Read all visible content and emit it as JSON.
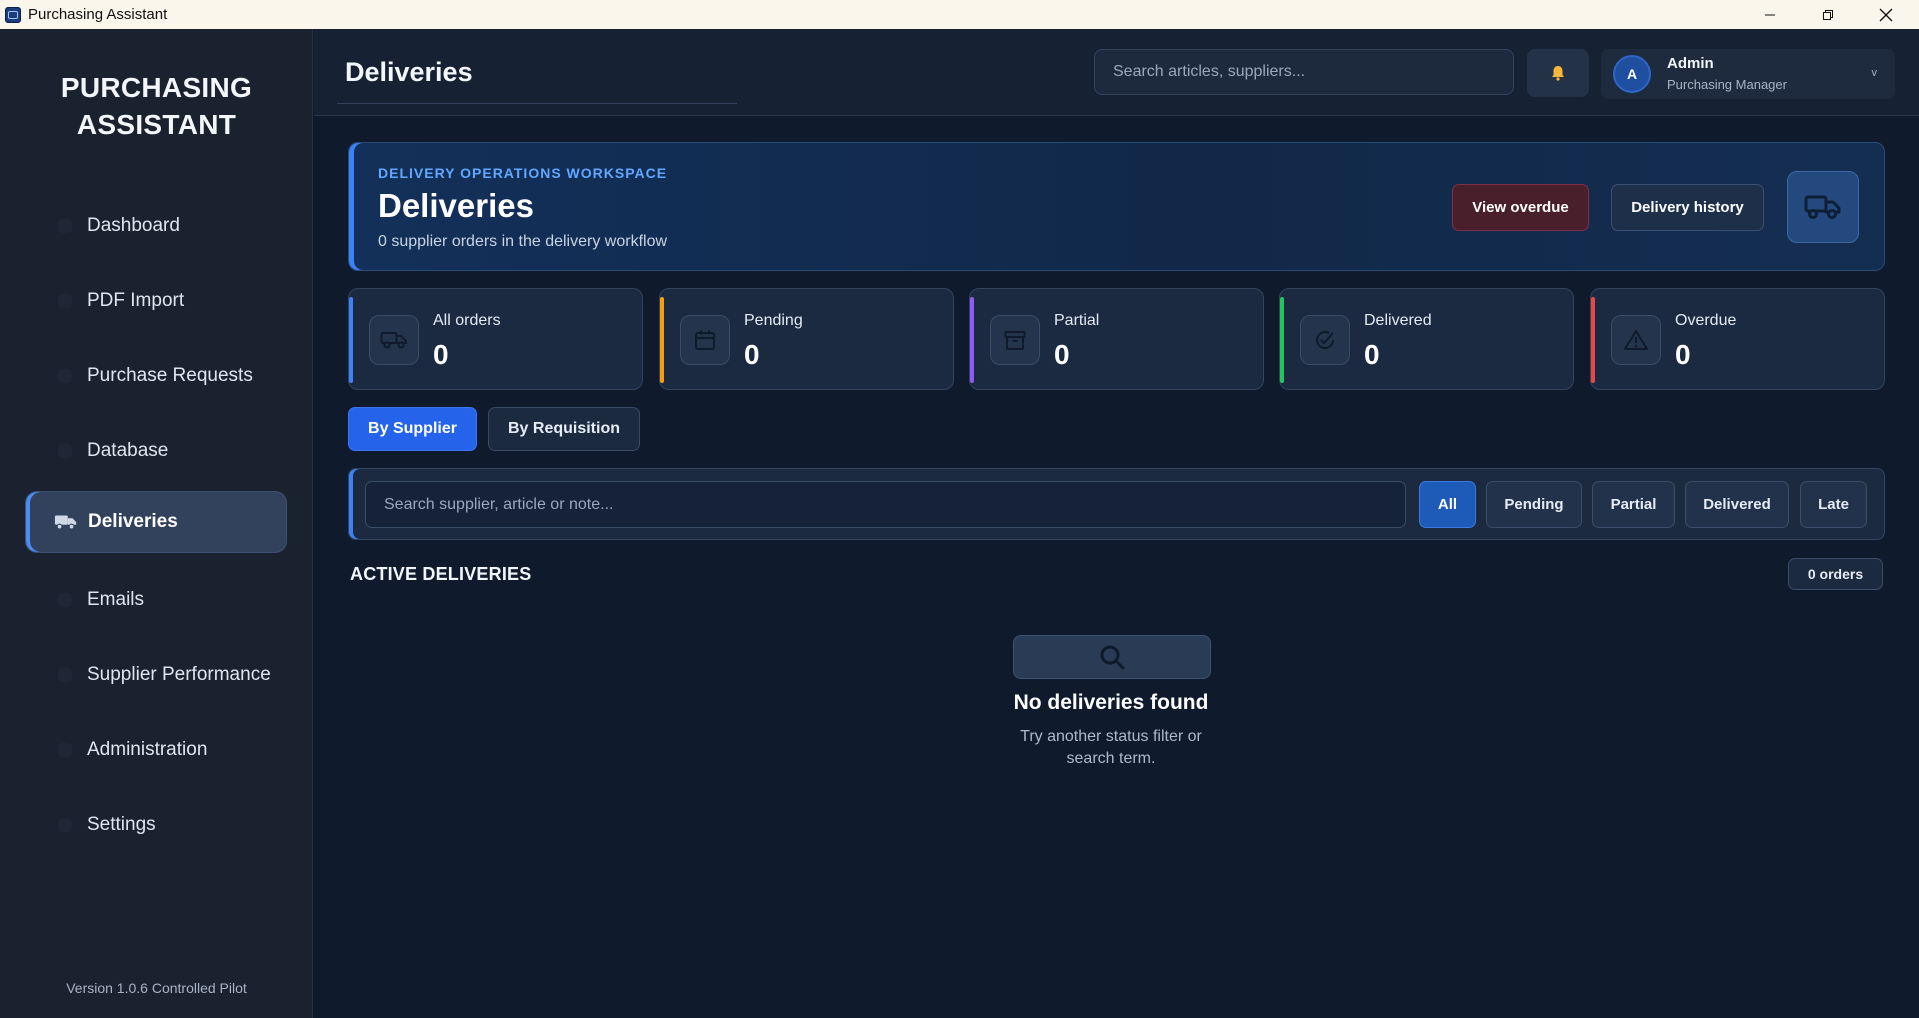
{
  "window": {
    "title": "Purchasing Assistant"
  },
  "sidebar": {
    "brand_line1": "PURCHASING",
    "brand_line2": "ASSISTANT",
    "items": [
      {
        "label": "Dashboard"
      },
      {
        "label": "PDF Import"
      },
      {
        "label": "Purchase Requests"
      },
      {
        "label": "Database"
      },
      {
        "label": "Deliveries",
        "active": true,
        "icon": "truck-icon"
      },
      {
        "label": "Emails"
      },
      {
        "label": "Supplier Performance"
      },
      {
        "label": "Administration"
      },
      {
        "label": "Settings"
      }
    ],
    "version": "Version 1.0.6 Controlled Pilot"
  },
  "header": {
    "page_title": "Deliveries",
    "search_placeholder": "Search articles, suppliers...",
    "notification_icon": "bell-icon",
    "user": {
      "initial": "A",
      "name": "Admin",
      "role": "Purchasing Manager",
      "menu_chevron": "v"
    }
  },
  "hero": {
    "eyebrow": "DELIVERY OPERATIONS WORKSPACE",
    "title": "Deliveries",
    "subtitle": "0 supplier orders in the delivery workflow",
    "view_overdue": "View overdue",
    "delivery_history": "Delivery history"
  },
  "stats": [
    {
      "label": "All orders",
      "value": "0",
      "icon": "truck-icon",
      "accent": "#3b82f6"
    },
    {
      "label": "Pending",
      "value": "0",
      "icon": "calendar-icon",
      "accent": "#f59e0b"
    },
    {
      "label": "Partial",
      "value": "0",
      "icon": "archive-icon",
      "accent": "#8b5cf6"
    },
    {
      "label": "Delivered",
      "value": "0",
      "icon": "check-circle-icon",
      "accent": "#22c55e"
    },
    {
      "label": "Overdue",
      "value": "0",
      "icon": "warning-icon",
      "accent": "#ef4444"
    }
  ],
  "view_toggle": {
    "by_supplier": "By Supplier",
    "by_requisition": "By Requisition",
    "active": "By Supplier"
  },
  "filter": {
    "search_placeholder": "Search supplier, article or note...",
    "chips": [
      "All",
      "Pending",
      "Partial",
      "Delivered",
      "Late"
    ],
    "active_chip": "All"
  },
  "section": {
    "title": "ACTIVE DELIVERIES",
    "count": "0 orders"
  },
  "empty": {
    "icon": "search-icon",
    "title": "No deliveries found",
    "subtitle": "Try another status filter or search term."
  },
  "colors": {
    "accent": "#2563eb",
    "background": "#0f1b2d",
    "sidebar": "#1a2230"
  }
}
